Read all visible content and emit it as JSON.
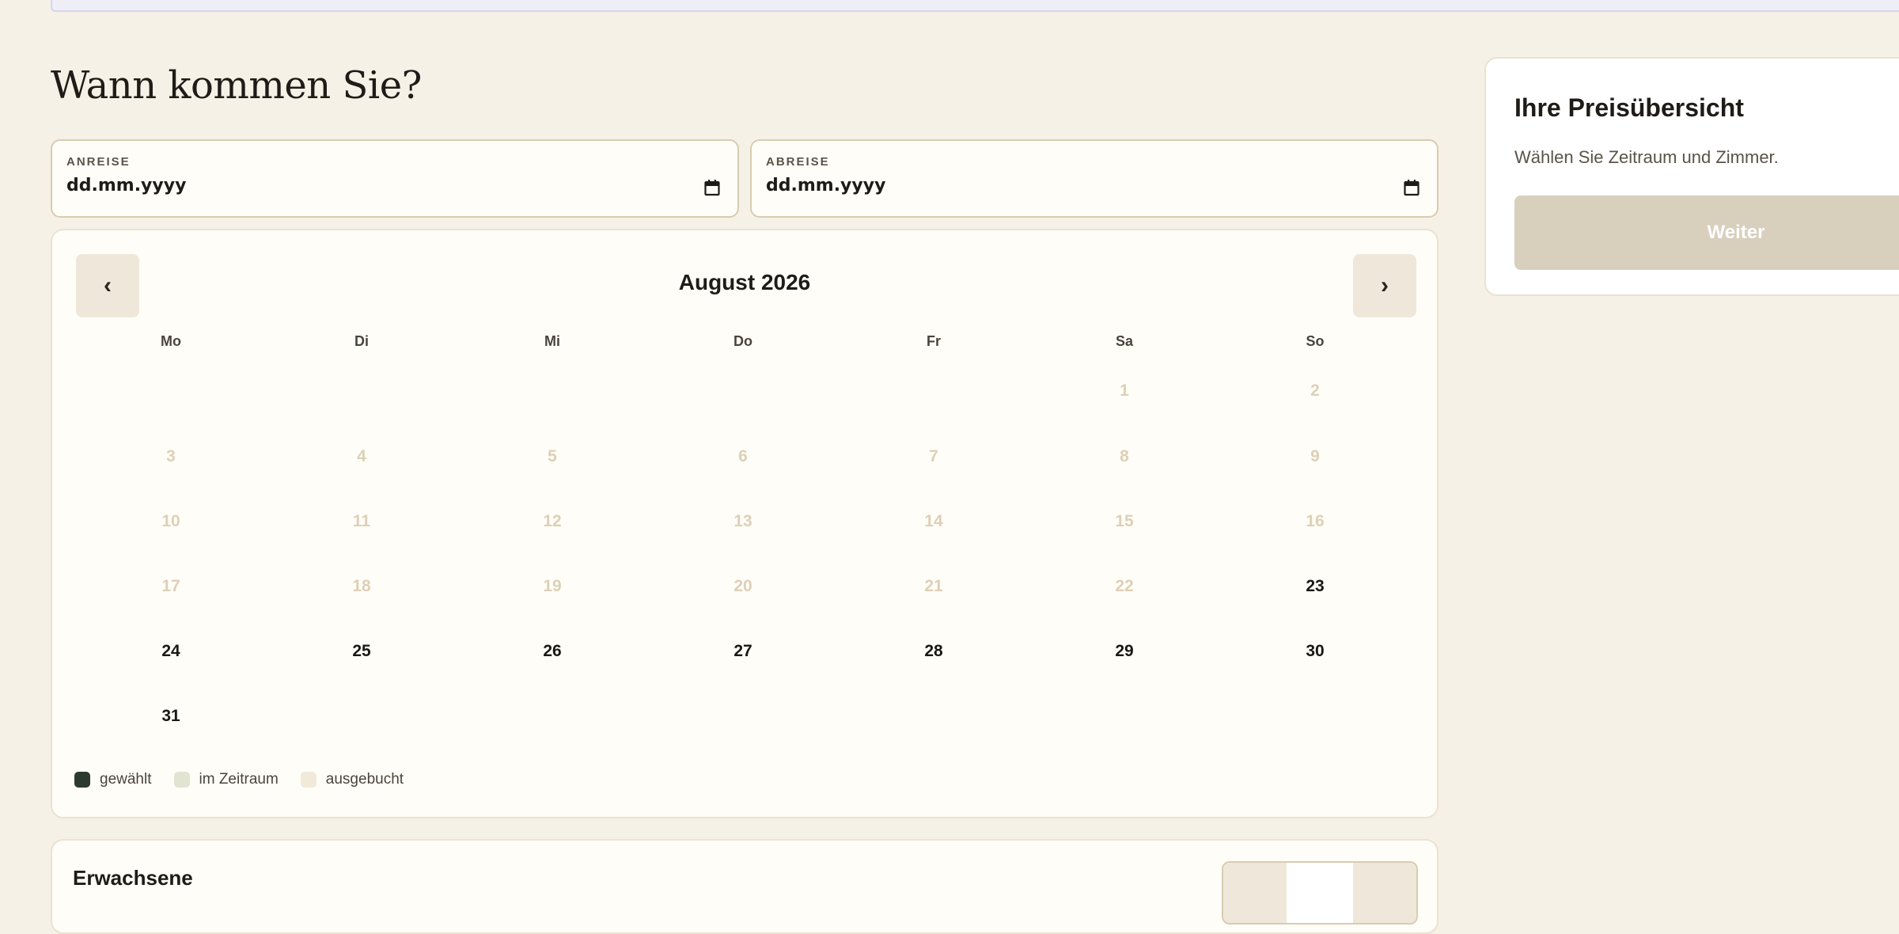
{
  "page": {
    "title": "Wann kommen Sie?"
  },
  "dates": {
    "arrival": {
      "label": "ANREISE",
      "value": "dd.mm.yyyy",
      "icon": "calendar-icon"
    },
    "departure": {
      "label": "ABREISE",
      "value": "dd.mm.yyyy",
      "icon": "calendar-icon"
    }
  },
  "calendar": {
    "month": "August 2026",
    "prev": "‹",
    "next": "›",
    "weekdays": [
      "Mo",
      "Di",
      "Mi",
      "Do",
      "Fr",
      "Sa",
      "So"
    ],
    "leading_blanks": 5,
    "days": [
      "1",
      "2",
      "3",
      "4",
      "5",
      "6",
      "7",
      "8",
      "9",
      "10",
      "11",
      "12",
      "13",
      "14",
      "15",
      "16",
      "17",
      "18",
      "19",
      "20",
      "21",
      "22",
      "23",
      "24",
      "25",
      "26",
      "27",
      "28",
      "29",
      "30",
      "31"
    ],
    "first_available_day": 23,
    "legend": [
      {
        "label": "gewählt",
        "color": "#2c3a2e"
      },
      {
        "label": "im Zeitraum",
        "color": "#e2e4d2"
      },
      {
        "label": "ausgebucht",
        "color": "#f1ead9"
      }
    ]
  },
  "guests": {
    "label": "Erwachsene"
  },
  "summary": {
    "title": "Ihre Preisübersicht",
    "text": "Wählen Sie Zeitraum und Zimmer.",
    "button": "Weiter"
  },
  "colors": {
    "background": "#f6f1e7",
    "accent_disabled": "#d8cfbd",
    "past_day": "#ddd0b6"
  }
}
